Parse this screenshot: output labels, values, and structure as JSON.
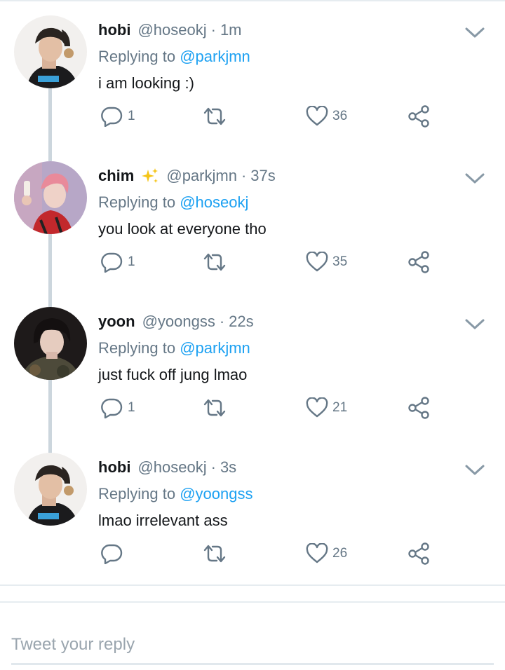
{
  "colors": {
    "link": "#1da1f2",
    "muted": "#657786",
    "thread_line": "#ccd6dd"
  },
  "tweets": [
    {
      "name": "hobi",
      "handle": "@hoseokj",
      "separator": "·",
      "time": "1m",
      "replying_prefix": "Replying to",
      "reply_to": "@parkjmn",
      "text": "i am looking :)",
      "reply_count": "1",
      "like_count": "36",
      "has_sparkle": false,
      "avatar_icon": "avatar-hobi"
    },
    {
      "name": "chim",
      "handle": "@parkjmn",
      "separator": "·",
      "time": "37s",
      "replying_prefix": "Replying to",
      "reply_to": "@hoseokj",
      "text": "you look at everyone tho",
      "reply_count": "1",
      "like_count": "35",
      "has_sparkle": true,
      "avatar_icon": "avatar-chim"
    },
    {
      "name": "yoon",
      "handle": "@yoongss",
      "separator": "·",
      "time": "22s",
      "replying_prefix": "Replying to",
      "reply_to": "@parkjmn",
      "text": "just fuck off jung lmao",
      "reply_count": "1",
      "like_count": "21",
      "has_sparkle": false,
      "avatar_icon": "avatar-yoon"
    },
    {
      "name": "hobi",
      "handle": "@hoseokj",
      "separator": "·",
      "time": "3s",
      "replying_prefix": "Replying to",
      "reply_to": "@yoongss",
      "text": "lmao irrelevant ass",
      "reply_count": "",
      "like_count": "26",
      "has_sparkle": false,
      "avatar_icon": "avatar-hobi"
    }
  ],
  "reply_box": {
    "placeholder": "Tweet your reply"
  }
}
